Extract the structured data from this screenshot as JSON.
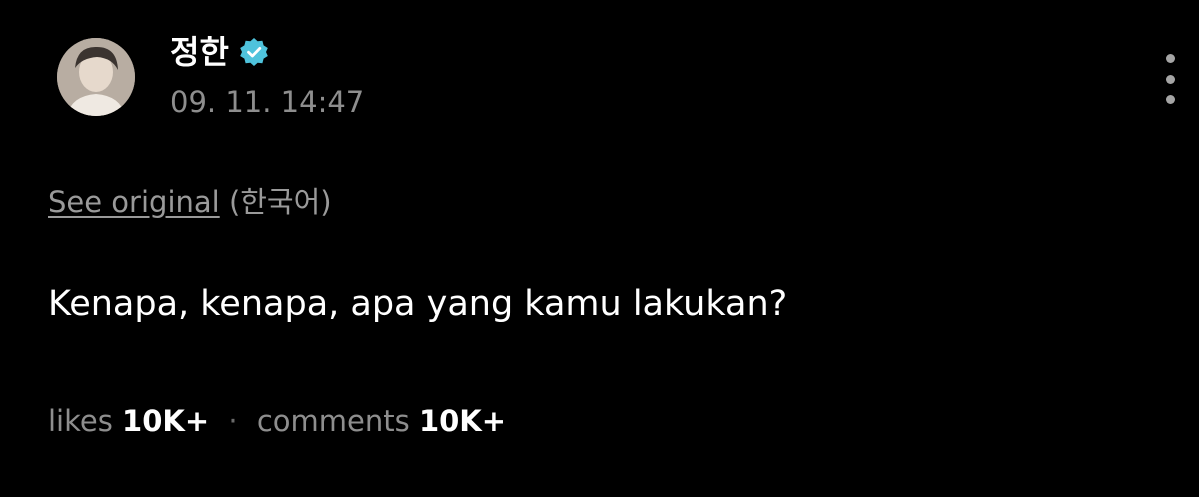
{
  "author": {
    "name": "정한",
    "verified_icon": "verified-check-icon",
    "verified_color": "#4fc3dc",
    "timestamp": "09. 11. 14:47"
  },
  "menu": {
    "icon": "more-vertical-icon"
  },
  "translation": {
    "see_original_label": "See original",
    "language_label": "(한국어)"
  },
  "post": {
    "text": "Kenapa, kenapa, apa yang kamu lakukan?"
  },
  "stats": {
    "likes_label": "likes",
    "likes_count": "10K+",
    "separator": "·",
    "comments_label": "comments",
    "comments_count": "10K+"
  }
}
